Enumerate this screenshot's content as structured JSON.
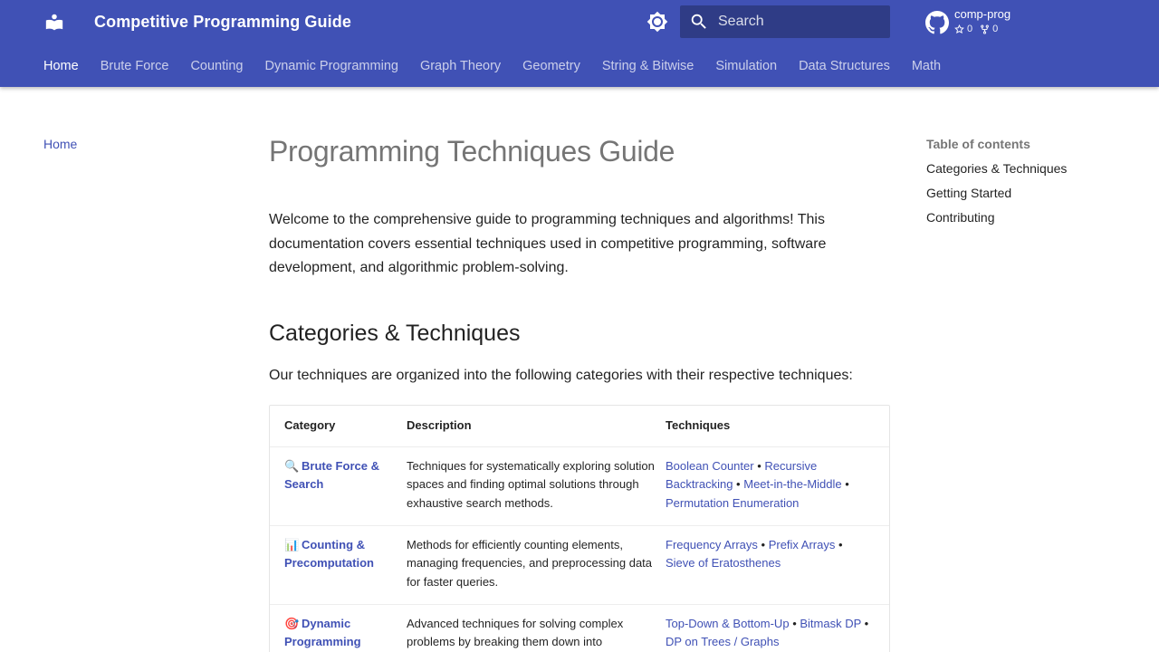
{
  "header": {
    "site_title": "Competitive Programming Guide",
    "search_placeholder": "Search",
    "repo_name": "comp-prog",
    "stars": "0",
    "forks": "0"
  },
  "tabs": [
    {
      "label": "Home",
      "active": true
    },
    {
      "label": "Brute Force"
    },
    {
      "label": "Counting"
    },
    {
      "label": "Dynamic Programming"
    },
    {
      "label": "Graph Theory"
    },
    {
      "label": "Geometry"
    },
    {
      "label": "String & Bitwise"
    },
    {
      "label": "Simulation"
    },
    {
      "label": "Data Structures"
    },
    {
      "label": "Math"
    }
  ],
  "sidebar": {
    "home": "Home"
  },
  "toc": {
    "title": "Table of contents",
    "items": [
      "Categories & Techniques",
      "Getting Started",
      "Contributing"
    ]
  },
  "content": {
    "title": "Programming Techniques Guide",
    "intro": "Welcome to the comprehensive guide to programming techniques and algorithms! This documentation covers essential techniques used in competitive programming, software development, and algorithmic problem-solving.",
    "section_title": "Categories & Techniques",
    "section_text": "Our techniques are organized into the following categories with their respective techniques:"
  },
  "table": {
    "headers": [
      "Category",
      "Description",
      "Techniques"
    ],
    "rows": [
      {
        "emoji": "🔍",
        "category": "Brute Force & Search",
        "description": "Techniques for systematically exploring solution spaces and finding optimal solutions through exhaustive search methods.",
        "techniques": [
          "Boolean Counter",
          "Recursive Backtracking",
          "Meet-in-the-Middle",
          "Permutation Enumeration"
        ]
      },
      {
        "emoji": "📊",
        "category": "Counting & Precomputation",
        "description": "Methods for efficiently counting elements, managing frequencies, and preprocessing data for faster queries.",
        "techniques": [
          "Frequency Arrays",
          "Prefix Arrays",
          "Sieve of Eratosthenes"
        ]
      },
      {
        "emoji": "🎯",
        "category": "Dynamic Programming",
        "description": "Advanced techniques for solving complex problems by breaking them down into",
        "techniques": [
          "Top-Down & Bottom-Up",
          "Bitmask DP",
          "DP on Trees / Graphs"
        ]
      }
    ]
  },
  "colors": {
    "primary": "#4051b5",
    "link": "#4051b5"
  }
}
